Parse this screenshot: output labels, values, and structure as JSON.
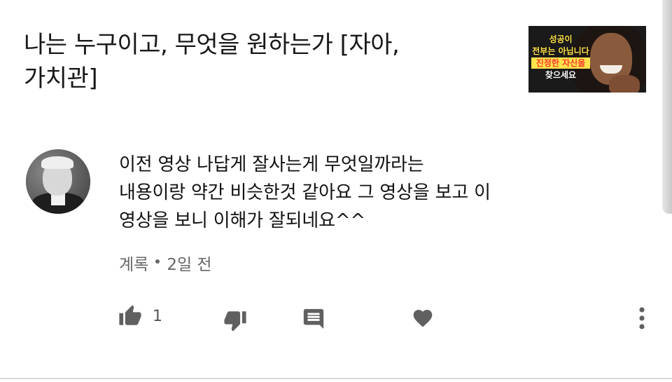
{
  "video": {
    "title_line1": "나는 누구이고, 무엇을 원하는가 [자아,",
    "title_line2": "가치관]",
    "thumbnail_text": [
      "성공이",
      "전부는 아닙니다",
      "진정한 자신을",
      "찾으세요"
    ]
  },
  "comment": {
    "text_line1": "이전 영상 나답게 잘사는게 무엇일까라는",
    "text_line2": "내용이랑 약간 비슷한것 같아요 그 영상을 보고 이",
    "text_line3": "영상을 보니 이해가 잘되네요^^",
    "author": "계록",
    "time": "2일 전",
    "like_count": "1"
  },
  "icons": {
    "like": "thumbs-up-icon",
    "dislike": "thumbs-down-icon",
    "reply": "comment-icon",
    "heart": "heart-icon",
    "more": "more-vertical-icon"
  },
  "colors": {
    "icon": "#606060",
    "meta_text": "#666666",
    "thumb_yellow": "#ffe34a",
    "thumb_red": "#ff3b2f"
  }
}
